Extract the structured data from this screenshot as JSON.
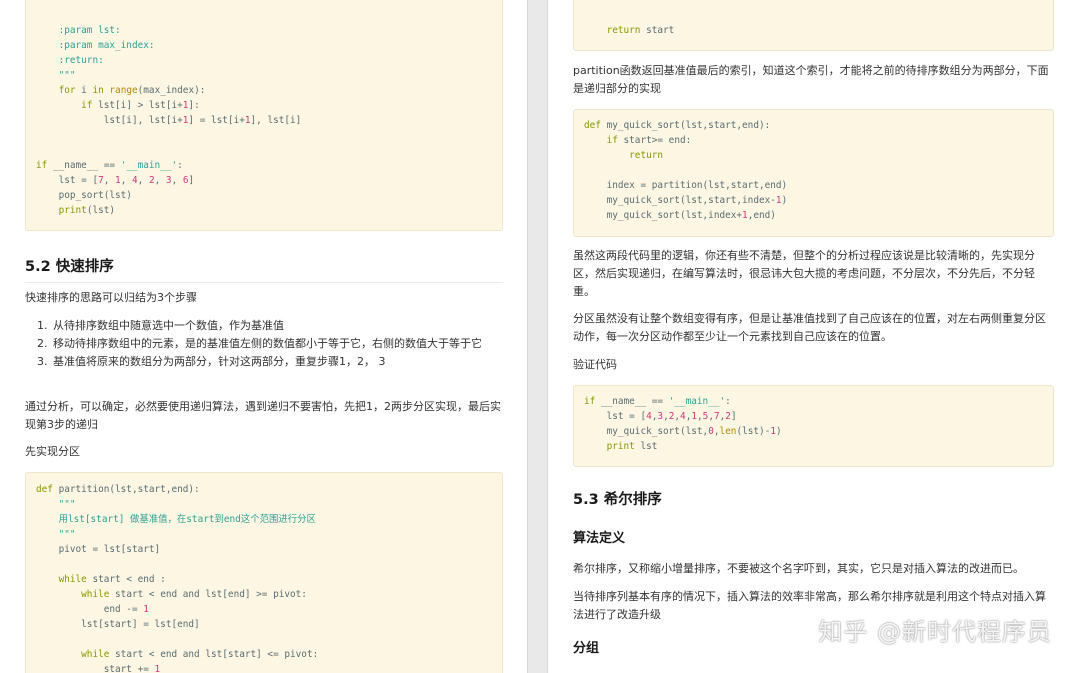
{
  "left": {
    "code1": [
      "    :param lst:",
      "    :param max_index:",
      "    :return:",
      "    \"\"\"",
      "    for i in range(max_index):",
      "        if lst[i] > lst[i+1]:",
      "            lst[i], lst[i+1] = lst[i+1], lst[i]",
      "",
      "",
      "if __name__ == '__main__':",
      "    lst = [7, 1, 4, 2, 3, 6]",
      "    pop_sort(lst)",
      "    print(lst)"
    ],
    "heading": "5.2 快速排序",
    "intro": "快速排序的思路可以归结为3个步骤",
    "steps": [
      "从待排序数组中随意选中一个数值，作为基准值",
      "移动待排序数组中的元素，是的基准值左侧的数值都小于等于它，右侧的数值大于等于它",
      "基准值将原来的数组分为两部分，针对这两部分，重复步骤1，2， 3"
    ],
    "analysis": "通过分析，可以确定，必然要使用递归算法，遇到递归不要害怕，先把1，2两步分区实现，最后实现第3步的递归",
    "partition_intro": "先实现分区",
    "code2": [
      "def partition(lst,start,end):",
      "    \"\"\"",
      "    用lst[start] 做基准值，在start到end这个范围进行分区",
      "    \"\"\"",
      "    pivot = lst[start]",
      "",
      "    while start < end :",
      "        while start < end and lst[end] >= pivot:",
      "            end -= 1",
      "        lst[start] = lst[end]",
      "",
      "        while start < end and lst[start] <= pivot:",
      "            start += 1"
    ]
  },
  "right": {
    "code1": [
      "    return start"
    ],
    "p1": "partition函数返回基准值最后的索引，知道这个索引，才能将之前的待排序数组分为两部分，下面是递归部分的实现",
    "code2": [
      "def my_quick_sort(lst,start,end):",
      "    if start>= end:",
      "        return",
      "",
      "    index = partition(lst,start,end)",
      "    my_quick_sort(lst,start,index-1)",
      "    my_quick_sort(lst,index+1,end)"
    ],
    "p2": "虽然这两段代码里的逻辑，你还有些不清楚，但整个的分析过程应该说是比较清晰的，先实现分区，然后实现递归，在编写算法时，很忌讳大包大揽的考虑问题，不分层次，不分先后，不分轻重。",
    "p3": "分区虽然没有让整个数组变得有序，但是让基准值找到了自己应该在的位置，对左右两侧重复分区动作，每一次分区动作都至少让一个元素找到自己应该在的位置。",
    "p4": "验证代码",
    "code3": [
      "if __name__ == '__main__':",
      "    lst = [4,3,2,4,1,5,7,2]",
      "    my_quick_sort(lst,0,len(lst)-1)",
      "    print lst"
    ],
    "heading": "5.3 希尔排序",
    "sub1": "算法定义",
    "p5": "希尔排序，又称缩小增量排序，不要被这个名字吓到，其实，它只是对插入算法的改进而已。",
    "p6": "当待排序列基本有序的情况下，插入算法的效率非常高，那么希尔排序就是利用这个特点对插入算法进行了改造升级",
    "sub2": "分组"
  },
  "watermark": "知乎 @新时代程序员"
}
